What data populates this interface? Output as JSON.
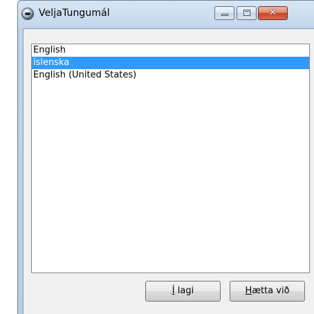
{
  "window": {
    "title": "VeljaTungumál",
    "icon": "phone-icon"
  },
  "caption_buttons": {
    "minimize_icon": "minimize-icon",
    "maximize_icon": "maximize-icon",
    "close_icon": "close-icon",
    "close_glyph": "✕"
  },
  "languages": {
    "items": [
      {
        "label": "English"
      },
      {
        "label": "íslenska"
      },
      {
        "label": "English (United States)"
      }
    ],
    "selected_index": 1
  },
  "buttons": {
    "ok": {
      "mnemonic": "Í",
      "rest": " lagi"
    },
    "cancel": {
      "mnemonic": "H",
      "rest": "ætta við"
    }
  },
  "colors": {
    "selection": "#3399ff",
    "close_button": "#c8462a"
  }
}
